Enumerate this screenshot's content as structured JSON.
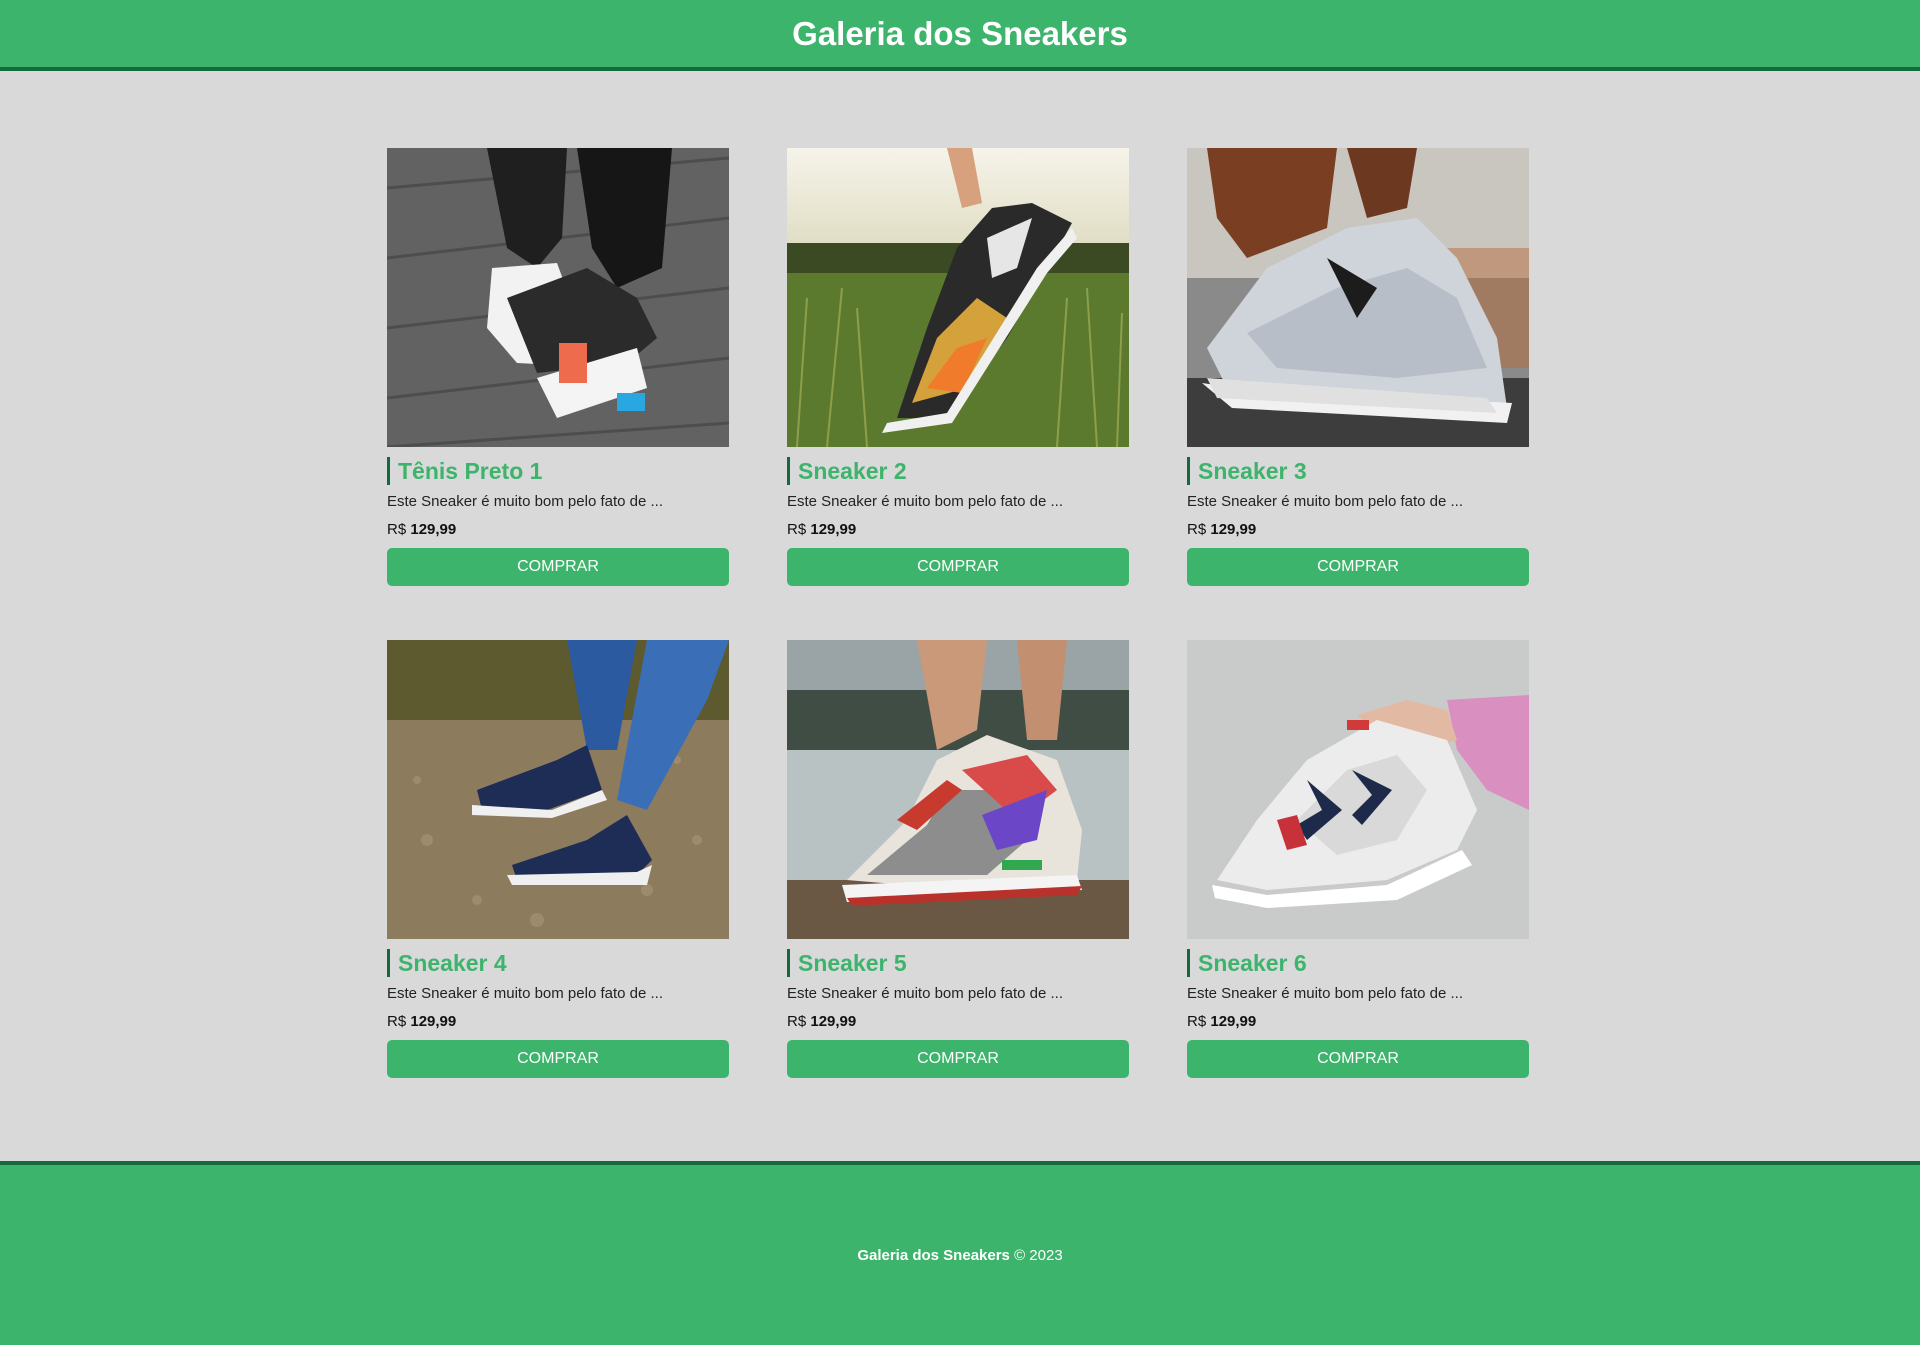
{
  "header": {
    "title": "Galeria dos Sneakers"
  },
  "products": [
    {
      "name": "Tênis Preto 1",
      "description": "Este Sneaker é muito bom pelo fato de ...",
      "currency": "R$",
      "price": "129,99",
      "button": "COMPRAR",
      "image": "black-sneaker-on-wood-deck-photo"
    },
    {
      "name": "Sneaker 2",
      "description": "Este Sneaker é muito bom pelo fato de ...",
      "currency": "R$",
      "price": "129,99",
      "button": "COMPRAR",
      "image": "sneaker-held-over-grass-field-photo"
    },
    {
      "name": "Sneaker 3",
      "description": "Este Sneaker é muito bom pelo fato de ...",
      "currency": "R$",
      "price": "129,99",
      "button": "COMPRAR",
      "image": "grey-sneaker-on-road-photo"
    },
    {
      "name": "Sneaker 4",
      "description": "Este Sneaker é muito bom pelo fato de ...",
      "currency": "R$",
      "price": "129,99",
      "button": "COMPRAR",
      "image": "navy-high-top-sneakers-on-gravel-photo"
    },
    {
      "name": "Sneaker 5",
      "description": "Este Sneaker é muito bom pelo fato de ...",
      "currency": "R$",
      "price": "129,99",
      "button": "COMPRAR",
      "image": "colorful-sneaker-closeup-photo"
    },
    {
      "name": "Sneaker 6",
      "description": "Este Sneaker é muito bom pelo fato de ...",
      "currency": "R$",
      "price": "129,99",
      "button": "COMPRAR",
      "image": "white-running-sneaker-held-photo"
    }
  ],
  "footer": {
    "brand": "Galeria dos Sneakers",
    "copyright": "© 2023"
  },
  "colors": {
    "primary": "#3db46c",
    "border": "#146a3a",
    "background": "#d9d9d9"
  }
}
